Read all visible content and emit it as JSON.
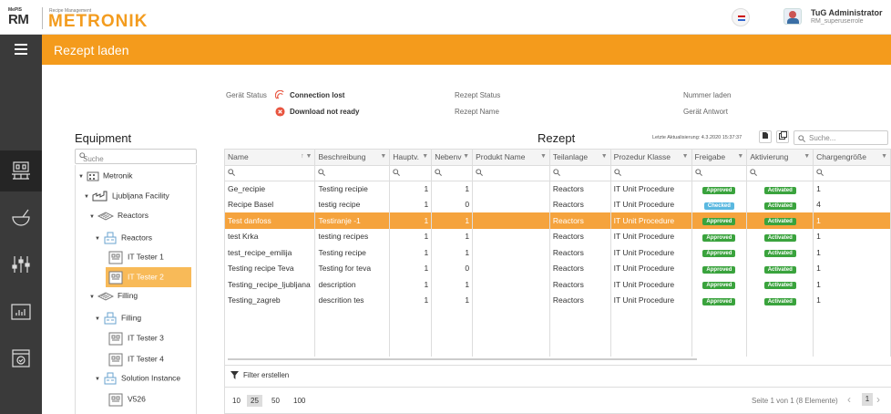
{
  "brand": {
    "small": "MePIS",
    "rm": "RM",
    "sub": "Recipe Management",
    "main": "METRONIK"
  },
  "user": {
    "name": "TuG Administrator",
    "role": "RM_superuserrole"
  },
  "page": {
    "title": "Rezept laden"
  },
  "info": {
    "geraet_status_label": "Gerät Status",
    "status1": "Connection lost",
    "status2": "Download not ready",
    "rezept_status_label": "Rezept Status",
    "rezept_name_label": "Rezept Name",
    "nummer_label": "Nummer laden",
    "antwort_label": "Gerät Antwort"
  },
  "equipment": {
    "title": "Equipment",
    "search_placeholder": "Suche",
    "tree": [
      {
        "label": "Metronik"
      },
      {
        "label": "Ljubljana Facility"
      },
      {
        "label": "Reactors"
      },
      {
        "label": "Reactors"
      },
      {
        "label": "IT Tester 1"
      },
      {
        "label": "IT Tester 2"
      },
      {
        "label": "Filling"
      },
      {
        "label": "Filling"
      },
      {
        "label": "IT Tester 3"
      },
      {
        "label": "IT Tester 4"
      },
      {
        "label": "Solution Instance"
      },
      {
        "label": "V526"
      }
    ]
  },
  "recipes": {
    "title": "Rezept",
    "last_update": "Letzte Aktualisierung: 4.3.2020 15:37:37",
    "search_placeholder": "Suche...",
    "columns": [
      "Name",
      "Beschreibung",
      "Hauptv.",
      "Nebenv",
      "Produkt Name",
      "Teilanlage",
      "Prozedur Klasse",
      "Freigabe",
      "Aktivierung",
      "Chargengröße"
    ],
    "rows": [
      [
        "Ge_recipie",
        "Testing recipie",
        "1",
        "1",
        "",
        "Reactors",
        "IT Unit Procedure",
        "Approved",
        "Activated",
        "1"
      ],
      [
        "Recipe Basel",
        "testig recipe",
        "1",
        "0",
        "",
        "Reactors",
        "IT Unit Procedure",
        "Checked",
        "Activated",
        "4"
      ],
      [
        "Test danfoss",
        "Testiranje -1",
        "1",
        "1",
        "",
        "Reactors",
        "IT Unit Procedure",
        "Approved",
        "Activated",
        "1"
      ],
      [
        "test Krka",
        "testing recipes",
        "1",
        "1",
        "",
        "Reactors",
        "IT Unit Procedure",
        "Approved",
        "Activated",
        "1"
      ],
      [
        "test_recipe_emilija",
        "Testing recipe",
        "1",
        "1",
        "",
        "Reactors",
        "IT Unit Procedure",
        "Approved",
        "Activated",
        "1"
      ],
      [
        "Testing recipe Teva",
        "Testing for teva",
        "1",
        "0",
        "",
        "Reactors",
        "IT Unit Procedure",
        "Approved",
        "Activated",
        "1"
      ],
      [
        "Testing_recipe_ljubljana",
        "description",
        "1",
        "1",
        "",
        "Reactors",
        "IT Unit Procedure",
        "Approved",
        "Activated",
        "1"
      ],
      [
        "Testing_zagreb",
        "descrition tes",
        "1",
        "1",
        "",
        "Reactors",
        "IT Unit Procedure",
        "Approved",
        "Activated",
        "1"
      ]
    ],
    "filter_label": "Filter erstellen",
    "page_sizes": [
      "10",
      "25",
      "50",
      "100"
    ],
    "page_info": "Seite 1 von 1 (8 Elemente)",
    "page_number": "1"
  },
  "colors": {
    "accent": "#f49b1c",
    "sidebar": "#3a3a3a",
    "selected_row": "#f5a33d",
    "approved": "#3aa33d",
    "checked": "#5ab8e0"
  }
}
